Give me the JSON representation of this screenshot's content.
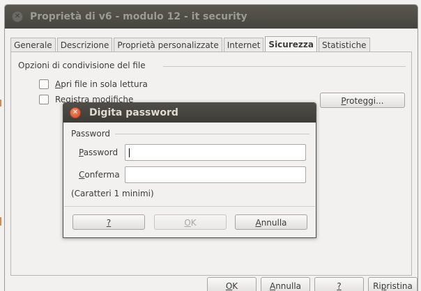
{
  "window": {
    "title": "Proprietà di v6 - modulo 12 - it security"
  },
  "tabs": [
    {
      "label": "Generale"
    },
    {
      "label": "Descrizione"
    },
    {
      "label": "Proprietà personalizzate"
    },
    {
      "label": "Internet"
    },
    {
      "label": "Sicurezza"
    },
    {
      "label": "Statistiche"
    }
  ],
  "sharing": {
    "group_title": "Opzioni di condivisione del file",
    "readonly_label_mn": "A",
    "readonly_label_rest": "pri file in sola lettura",
    "record_label_pre": "Re",
    "record_label_mn": "g",
    "record_label_rest": "istra modifiche",
    "protect_button_mn": "P",
    "protect_button_rest": "roteggi..."
  },
  "password_dialog": {
    "title": "Digita password",
    "group_title": "Password",
    "password_label_mn": "P",
    "password_label_rest": "assword",
    "password_value": "",
    "confirm_label_mn": "C",
    "confirm_label_rest": "onferma",
    "confirm_value": "",
    "hint": "(Caratteri 1 minimi)",
    "help_button": "?",
    "ok_button_mn": "O",
    "ok_button_rest": "K",
    "cancel_button_mn": "A",
    "cancel_button_rest": "nnulla"
  },
  "footer": {
    "ok_mn": "O",
    "ok_rest": "K",
    "cancel_mn": "A",
    "cancel_rest": "nnulla",
    "help": "?",
    "reset_pre": "Ri",
    "reset_mn": "p",
    "reset_rest": "ristina"
  }
}
